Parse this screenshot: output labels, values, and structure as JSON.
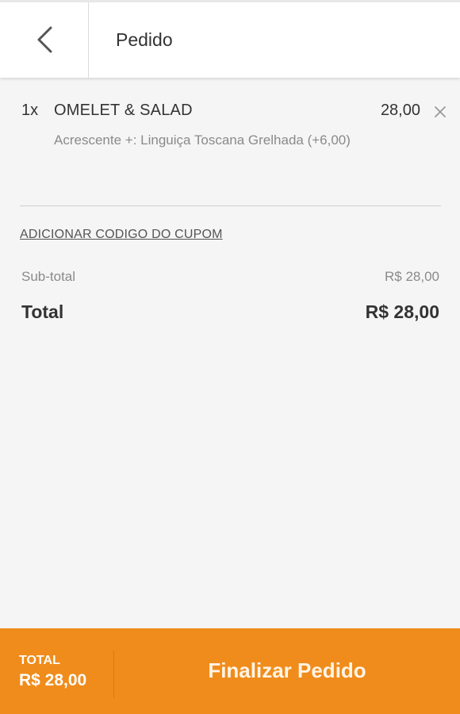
{
  "header": {
    "title": "Pedido",
    "back_icon": "chevron-left-icon"
  },
  "order": {
    "items": [
      {
        "quantity": "1x",
        "name": "OMELET & SALAD",
        "price": "28,00",
        "addon": "Acrescente +: Linguiça Toscana Grelhada (+6,00)",
        "remove_icon": "close-icon"
      }
    ]
  },
  "coupon": {
    "link_label": "ADICIONAR CODIGO DO CUPOM"
  },
  "summary": {
    "subtotal_label": "Sub-total",
    "subtotal_value": "R$ 28,00",
    "total_label": "Total",
    "total_value": "R$ 28,00"
  },
  "footer": {
    "total_label": "TOTAL",
    "total_value": "R$ 28,00",
    "finalize_label": "Finalizar Pedido"
  },
  "colors": {
    "accent": "#f08c1b",
    "background": "#f5f5f5",
    "header_background": "#ffffff",
    "text_primary": "#333333",
    "text_secondary": "#8a8a8a"
  }
}
